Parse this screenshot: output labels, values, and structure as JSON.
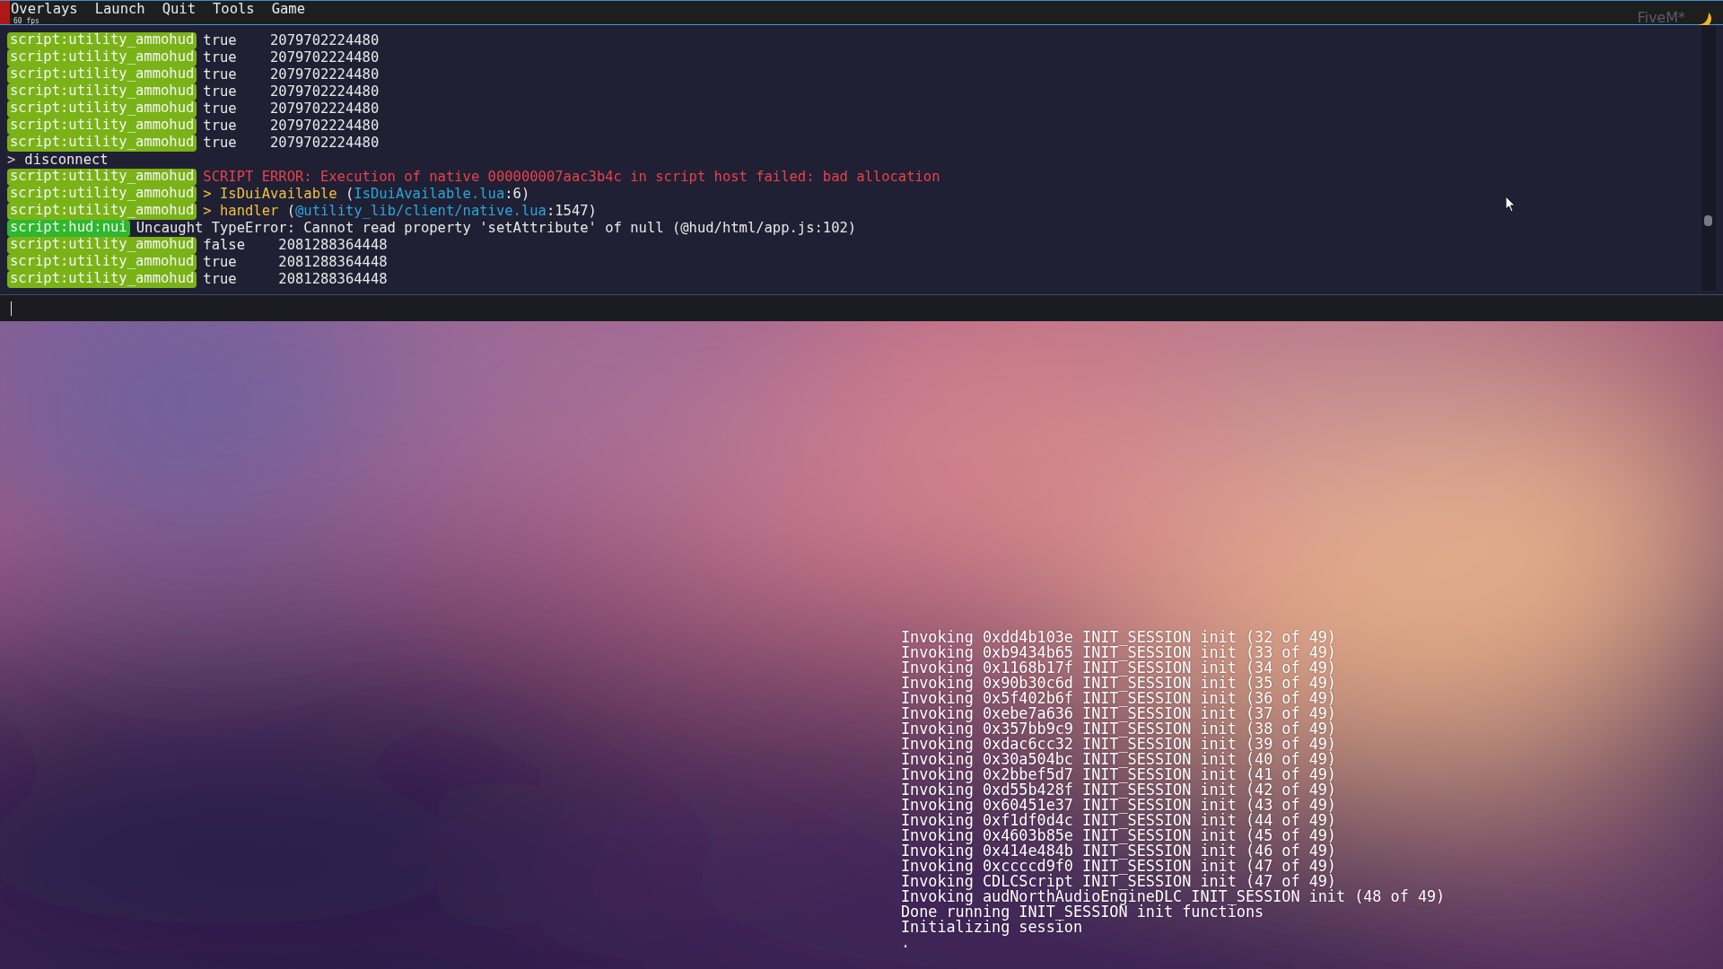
{
  "menu_bar": {
    "items": [
      "Overlays",
      "Launch",
      "Quit",
      "Tools",
      "Game"
    ],
    "fps": "60 fps",
    "brand": "FiveM*"
  },
  "console": {
    "lines": [
      {
        "kind": "log",
        "channel": "script:utility_ammohud",
        "color": "#7ab317",
        "segments": [
          {
            "kind": "plain",
            "text": "true    2079702224480"
          }
        ]
      },
      {
        "kind": "log",
        "channel": "script:utility_ammohud",
        "color": "#7ab317",
        "segments": [
          {
            "kind": "plain",
            "text": "true    2079702224480"
          }
        ]
      },
      {
        "kind": "log",
        "channel": "script:utility_ammohud",
        "color": "#7ab317",
        "segments": [
          {
            "kind": "plain",
            "text": "true    2079702224480"
          }
        ]
      },
      {
        "kind": "log",
        "channel": "script:utility_ammohud",
        "color": "#7ab317",
        "segments": [
          {
            "kind": "plain",
            "text": "true    2079702224480"
          }
        ]
      },
      {
        "kind": "log",
        "channel": "script:utility_ammohud",
        "color": "#7ab317",
        "segments": [
          {
            "kind": "plain",
            "text": "true    2079702224480"
          }
        ]
      },
      {
        "kind": "log",
        "channel": "script:utility_ammohud",
        "color": "#7ab317",
        "segments": [
          {
            "kind": "plain",
            "text": "true    2079702224480"
          }
        ]
      },
      {
        "kind": "log",
        "channel": "script:utility_ammohud",
        "color": "#7ab317",
        "segments": [
          {
            "kind": "plain",
            "text": "true    2079702224480"
          }
        ]
      },
      {
        "kind": "command",
        "prompt": ">",
        "text": "disconnect"
      },
      {
        "kind": "log",
        "channel": "script:utility_ammohud",
        "color": "#7ab317",
        "segments": [
          {
            "kind": "error",
            "text": "SCRIPT ERROR: Execution of native 000000007aac3b4c in script host failed: bad allocation"
          }
        ]
      },
      {
        "kind": "log",
        "channel": "script:utility_ammohud",
        "color": "#7ab317",
        "segments": [
          {
            "kind": "trace",
            "text": "> IsDuiAvailable"
          },
          {
            "kind": "plain",
            "text": " ("
          },
          {
            "kind": "link",
            "text": "IsDuiAvailable.lua"
          },
          {
            "kind": "plain",
            "text": ":6)"
          }
        ]
      },
      {
        "kind": "log",
        "channel": "script:utility_ammohud",
        "color": "#7ab317",
        "segments": [
          {
            "kind": "trace",
            "text": "> handler"
          },
          {
            "kind": "plain",
            "text": " ("
          },
          {
            "kind": "link",
            "text": "@utility_lib/client/native.lua"
          },
          {
            "kind": "plain",
            "text": ":1547)"
          }
        ]
      },
      {
        "kind": "log",
        "channel": "script:hud:nui",
        "color": "#2eb82e",
        "segments": [
          {
            "kind": "plain",
            "text": "Uncaught TypeError: Cannot read property 'setAttribute' of null (@hud/html/app.js:102)"
          }
        ]
      },
      {
        "kind": "log",
        "channel": "script:utility_ammohud",
        "color": "#7ab317",
        "segments": [
          {
            "kind": "plain",
            "text": "false    2081288364448"
          }
        ]
      },
      {
        "kind": "log",
        "channel": "script:utility_ammohud",
        "color": "#7ab317",
        "segments": [
          {
            "kind": "plain",
            "text": "true     2081288364448"
          }
        ]
      },
      {
        "kind": "log",
        "channel": "script:utility_ammohud",
        "color": "#7ab317",
        "segments": [
          {
            "kind": "plain",
            "text": "true     2081288364448"
          }
        ]
      }
    ]
  },
  "loading_log": [
    "Invoking 0xdd4b103e INIT_SESSION init (32 of 49)",
    "Invoking 0xb9434b65 INIT_SESSION init (33 of 49)",
    "Invoking 0x1168b17f INIT_SESSION init (34 of 49)",
    "Invoking 0x90b30c6d INIT_SESSION init (35 of 49)",
    "Invoking 0x5f402b6f INIT_SESSION init (36 of 49)",
    "Invoking 0xebe7a636 INIT_SESSION init (37 of 49)",
    "Invoking 0x357bb9c9 INIT_SESSION init (38 of 49)",
    "Invoking 0xdac6cc32 INIT_SESSION init (39 of 49)",
    "Invoking 0x30a504bc INIT_SESSION init (40 of 49)",
    "Invoking 0x2bbef5d7 INIT_SESSION init (41 of 49)",
    "Invoking 0xd55b428f INIT_SESSION init (42 of 49)",
    "Invoking 0x60451e37 INIT_SESSION init (43 of 49)",
    "Invoking 0xf1df0d4c INIT_SESSION init (44 of 49)",
    "Invoking 0x4603b85e INIT_SESSION init (45 of 49)",
    "Invoking 0x414e484b INIT_SESSION init (46 of 49)",
    "Invoking 0xccccd9f0 INIT_SESSION init (47 of 49)",
    "Invoking CDLCScript INIT_SESSION init (47 of 49)",
    "Invoking audNorthAudioEngineDLC INIT_SESSION init (48 of 49)",
    "Done running INIT_SESSION init functions",
    "Initializing session",
    "."
  ]
}
